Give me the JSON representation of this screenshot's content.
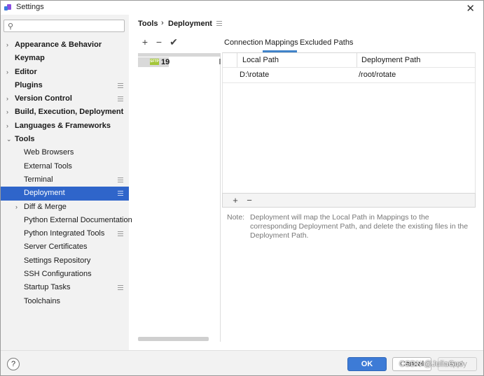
{
  "window": {
    "title": "Settings"
  },
  "search": {
    "placeholder": "",
    "value": ""
  },
  "tree": [
    {
      "label": "Appearance & Behavior",
      "level": 0,
      "arrow": true,
      "gear": false,
      "selected": false
    },
    {
      "label": "Keymap",
      "level": 0,
      "arrow": false,
      "gear": false,
      "selected": false
    },
    {
      "label": "Editor",
      "level": 0,
      "arrow": true,
      "gear": false,
      "selected": false
    },
    {
      "label": "Plugins",
      "level": 0,
      "arrow": false,
      "gear": true,
      "selected": false
    },
    {
      "label": "Version Control",
      "level": 0,
      "arrow": true,
      "gear": true,
      "selected": false
    },
    {
      "label": "Build, Execution, Deployment",
      "level": 0,
      "arrow": true,
      "gear": false,
      "selected": false
    },
    {
      "label": "Languages & Frameworks",
      "level": 0,
      "arrow": true,
      "gear": false,
      "selected": false
    },
    {
      "label": "Tools",
      "level": 0,
      "arrow": true,
      "expanded": true,
      "gear": false,
      "selected": false
    },
    {
      "label": "Web Browsers",
      "level": 1,
      "arrow": false,
      "gear": false,
      "selected": false
    },
    {
      "label": "External Tools",
      "level": 1,
      "arrow": false,
      "gear": false,
      "selected": false
    },
    {
      "label": "Terminal",
      "level": 1,
      "arrow": false,
      "gear": true,
      "selected": false
    },
    {
      "label": "Deployment",
      "level": 1,
      "arrow": false,
      "gear": true,
      "selected": true
    },
    {
      "label": "Diff & Merge",
      "level": 1,
      "arrow": true,
      "gear": false,
      "selected": false
    },
    {
      "label": "Python External Documentation",
      "level": 1,
      "arrow": false,
      "gear": false,
      "selected": false
    },
    {
      "label": "Python Integrated Tools",
      "level": 1,
      "arrow": false,
      "gear": true,
      "selected": false
    },
    {
      "label": "Server Certificates",
      "level": 1,
      "arrow": false,
      "gear": false,
      "selected": false
    },
    {
      "label": "Settings Repository",
      "level": 1,
      "arrow": false,
      "gear": false,
      "selected": false
    },
    {
      "label": "SSH Configurations",
      "level": 1,
      "arrow": false,
      "gear": false,
      "selected": false
    },
    {
      "label": "Startup Tasks",
      "level": 1,
      "arrow": false,
      "gear": true,
      "selected": false
    },
    {
      "label": "Toolchains",
      "level": 1,
      "arrow": false,
      "gear": false,
      "selected": false
    }
  ],
  "breadcrumb": {
    "parent": "Tools",
    "separator": "›",
    "current": "Deployment"
  },
  "servers": {
    "toolbar": {
      "add": "+",
      "remove": "−",
      "apply": "✔"
    },
    "items": [
      {
        "name": "19",
        "icon": "sftp-icon",
        "icon_text": "SFTP"
      }
    ]
  },
  "tabs": [
    {
      "label": "Connection",
      "active": false
    },
    {
      "label": "Mappings",
      "active": true
    },
    {
      "label": "Excluded Paths",
      "active": false
    }
  ],
  "mappings": {
    "columns": [
      "Local Path",
      "Deployment Path"
    ],
    "rows": [
      {
        "local": "D:\\rotate",
        "deployment": "/root/rotate"
      }
    ],
    "toolbar": {
      "add": "+",
      "remove": "−"
    }
  },
  "note": {
    "label": "Note:",
    "text": "Deployment will map the Local Path in Mappings to the corresponding Deployment Path, and delete the existing files in the Deployment Path."
  },
  "footer": {
    "help": "?",
    "ok": "OK",
    "cancel": "Cancel",
    "apply": "Apply",
    "watermark": "CSDN @JuliaGuo"
  },
  "colors": {
    "selection": "#2f65ca",
    "ok_button": "#3d7bd6",
    "tab_underline": "#4083c9",
    "sidebar_bg": "#f2f2f2"
  }
}
